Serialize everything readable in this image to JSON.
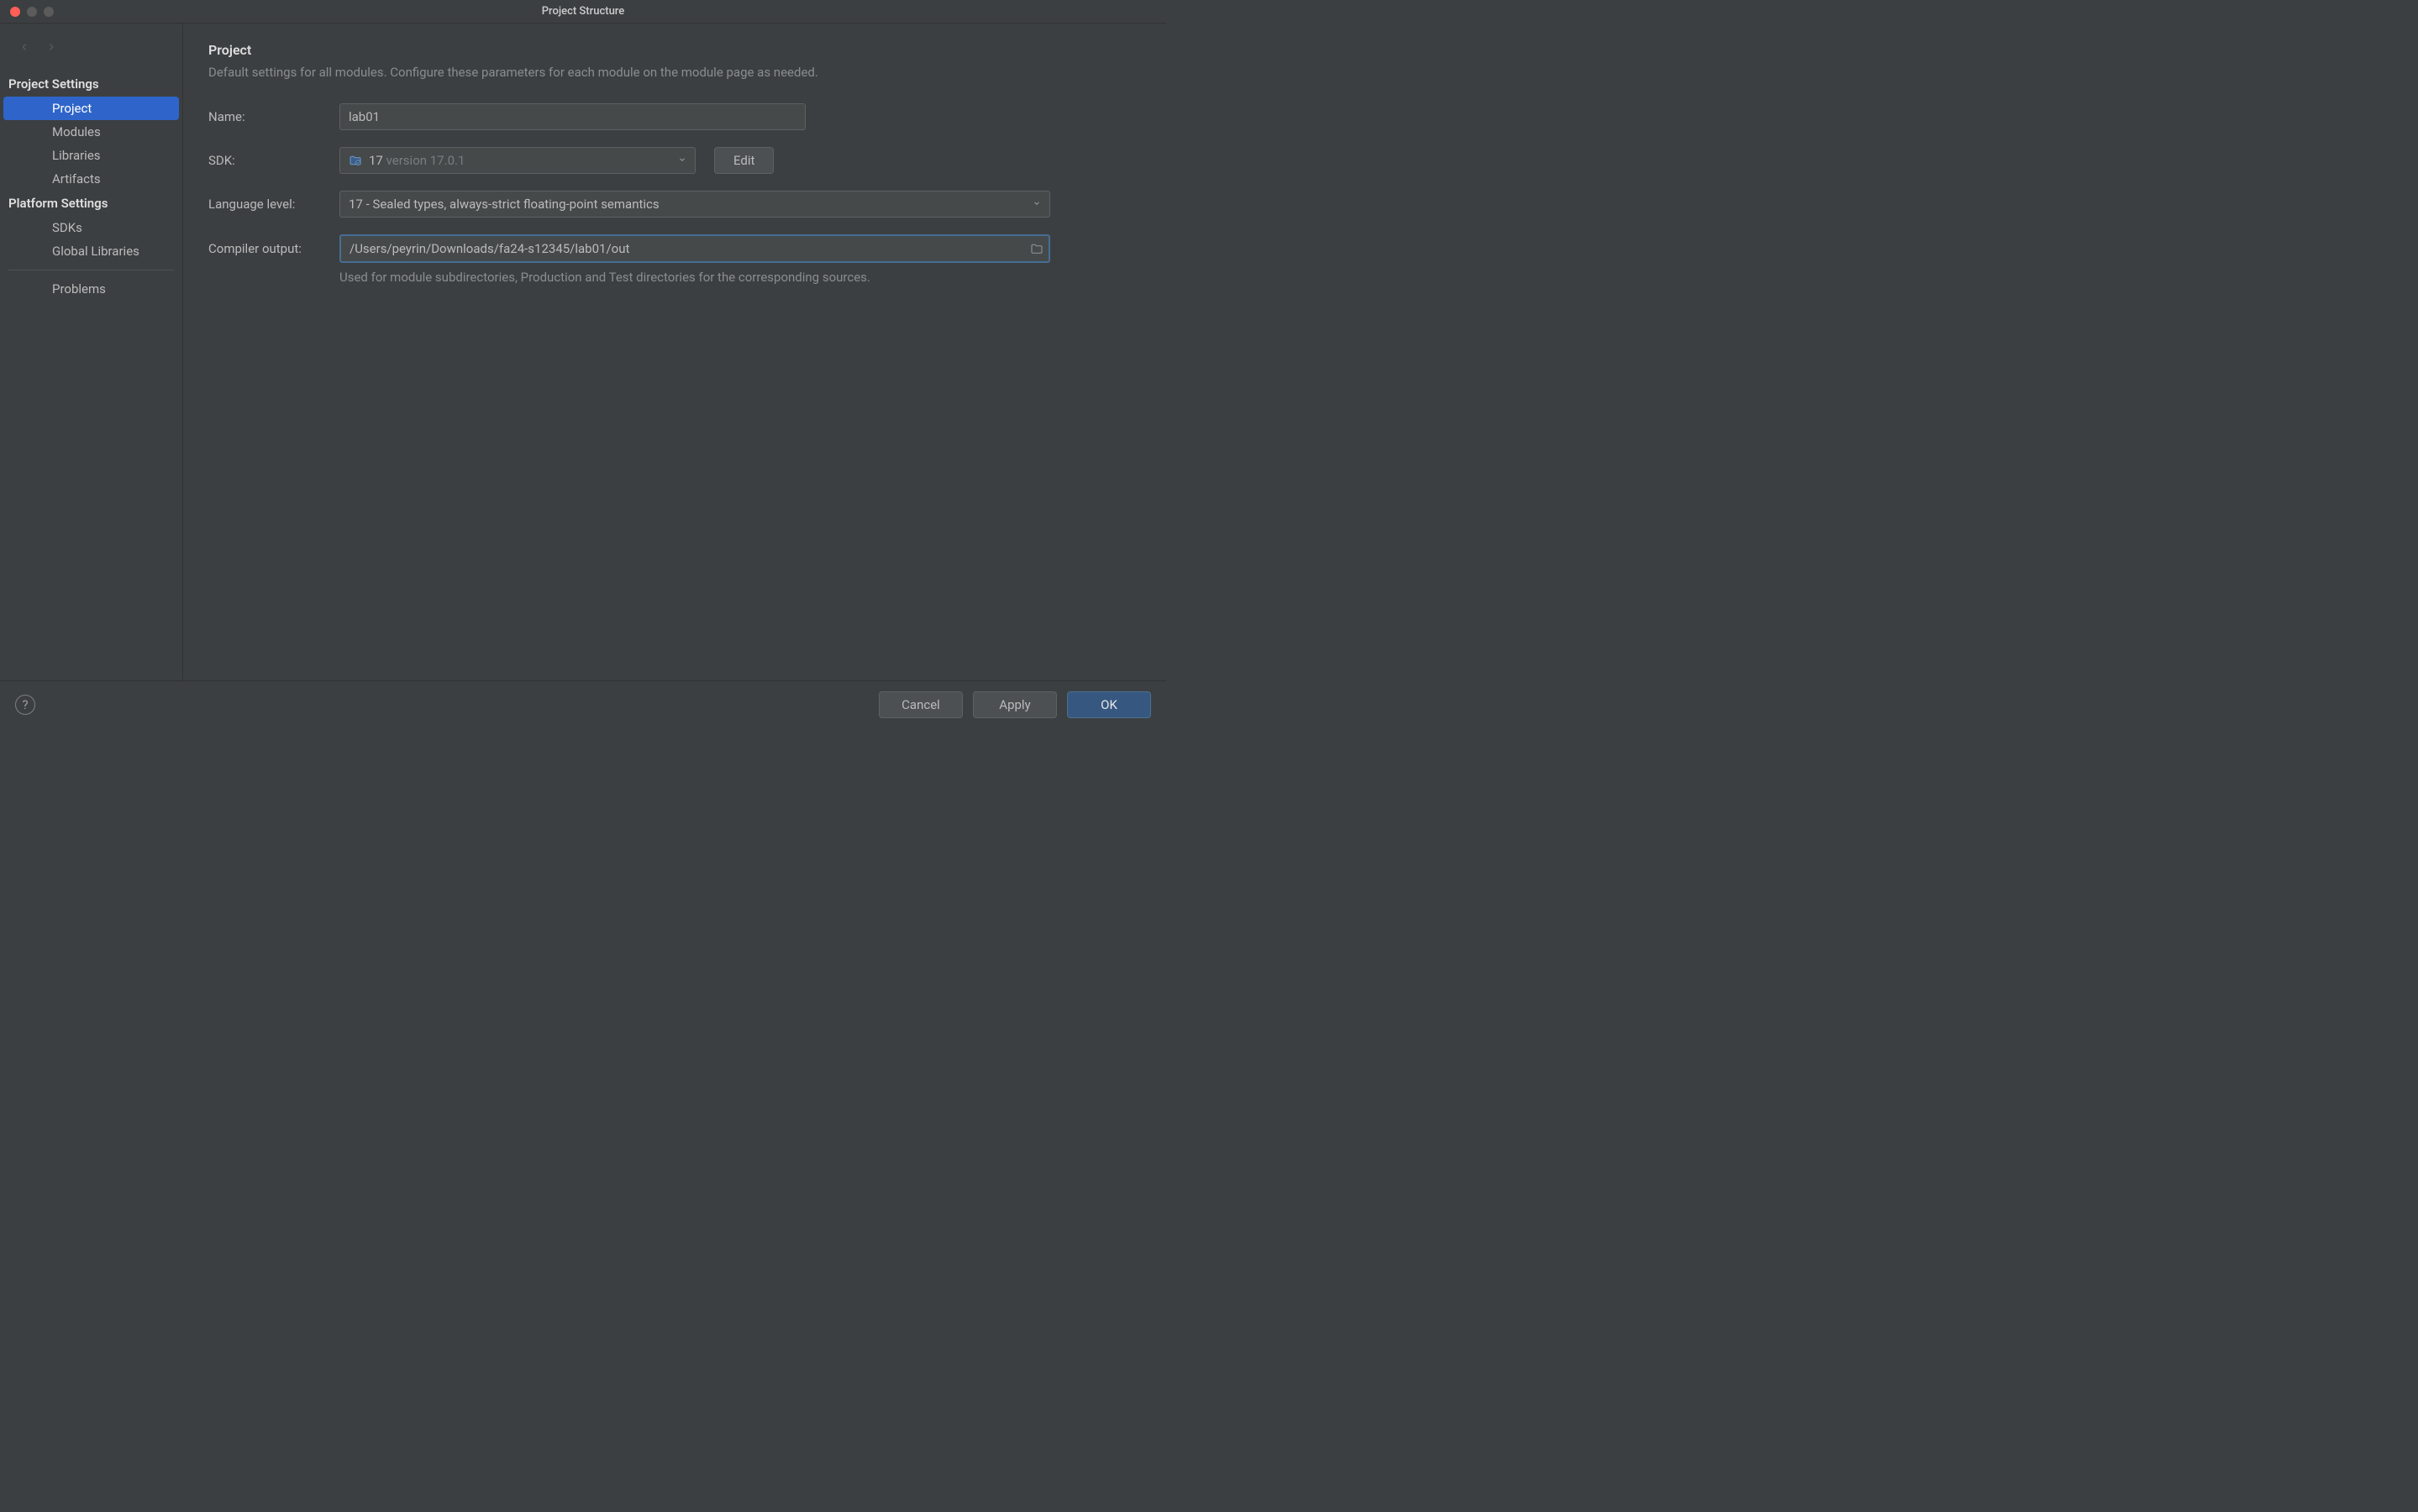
{
  "window": {
    "title": "Project Structure"
  },
  "sidebar": {
    "sections": [
      {
        "header": "Project Settings",
        "items": [
          {
            "label": "Project",
            "selected": true
          },
          {
            "label": "Modules",
            "selected": false
          },
          {
            "label": "Libraries",
            "selected": false
          },
          {
            "label": "Artifacts",
            "selected": false
          }
        ]
      },
      {
        "header": "Platform Settings",
        "items": [
          {
            "label": "SDKs",
            "selected": false
          },
          {
            "label": "Global Libraries",
            "selected": false
          }
        ]
      }
    ],
    "problems": "Problems"
  },
  "main": {
    "title": "Project",
    "subtitle": "Default settings for all modules. Configure these parameters for each module on the module page as needed.",
    "fields": {
      "name_label": "Name:",
      "name_value": "lab01",
      "sdk_label": "SDK:",
      "sdk_value_num": "17",
      "sdk_value_ver": " version 17.0.1",
      "edit_button": "Edit",
      "lang_label": "Language level:",
      "lang_value": "17 - Sealed types, always-strict floating-point semantics",
      "compiler_label": "Compiler output:",
      "compiler_value": "/Users/peyrin/Downloads/fa24-s12345/lab01/out",
      "compiler_helper": "Used for module subdirectories, Production and Test directories for the corresponding sources."
    }
  },
  "footer": {
    "cancel": "Cancel",
    "apply": "Apply",
    "ok": "OK"
  }
}
